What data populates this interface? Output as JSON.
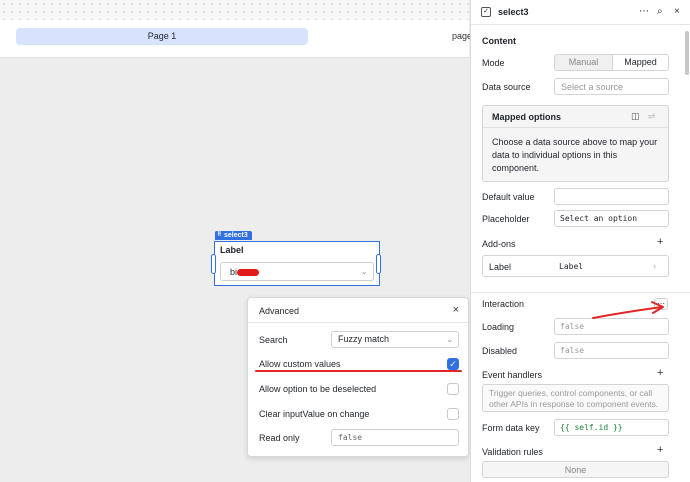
{
  "canvas": {
    "page_tab": "Page 1",
    "page_tab2": "page",
    "component": {
      "badge": "select3",
      "label": "Label",
      "value": "bi"
    }
  },
  "advanced": {
    "title": "Advanced",
    "search_label": "Search",
    "search_value": "Fuzzy match",
    "allow_custom_label": "Allow custom values",
    "deselect_label": "Allow option to be deselected",
    "clear_label": "Clear inputValue on change",
    "readonly_label": "Read only",
    "readonly_value": "false"
  },
  "panel": {
    "component_name": "select3",
    "content_title": "Content",
    "mode_label": "Mode",
    "mode_options": [
      "Manual",
      "Mapped"
    ],
    "data_source_label": "Data source",
    "data_source_placeholder": "Select a source",
    "mapped_title": "Mapped options",
    "mapped_text": "Choose a data source above to map your data to individual options in this component.",
    "default_value_label": "Default value",
    "placeholder_label": "Placeholder",
    "placeholder_value": "Select an option",
    "addons_title": "Add-ons",
    "addon_item_label": "Label",
    "addon_item_value": "Label",
    "interaction_title": "Interaction",
    "loading_label": "Loading",
    "loading_value": "false",
    "disabled_label": "Disabled",
    "disabled_value": "false",
    "event_handlers_title": "Event handlers",
    "event_handlers_text": "Trigger queries, control components, or call other APIs in response to component events.",
    "form_key_label": "Form data key",
    "form_key_value": "{{ self.id }}",
    "validation_title": "Validation rules",
    "validation_value": "None"
  },
  "colors": {
    "accent": "#3170e0",
    "annotation": "#e32424"
  }
}
